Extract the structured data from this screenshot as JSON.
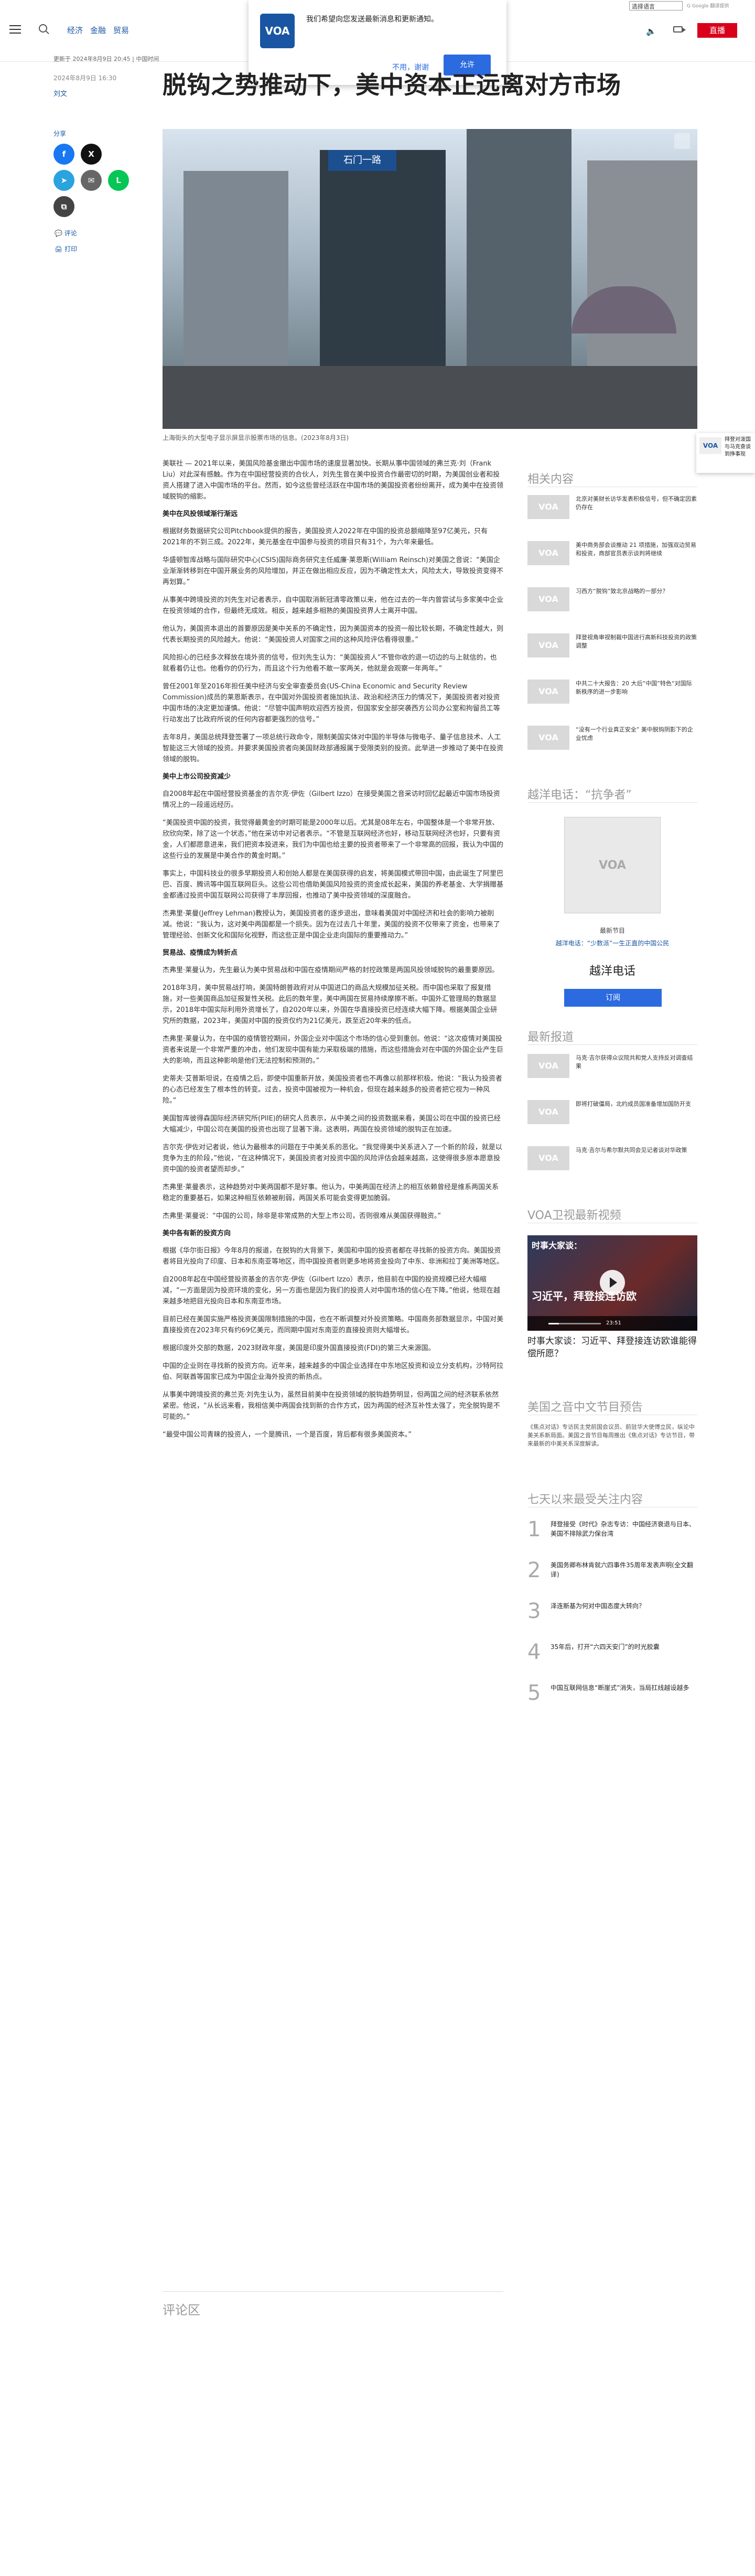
{
  "header": {
    "nav_links": [
      "经济",
      "金融",
      "贸易"
    ],
    "lang_select": "选择语言",
    "google_translate": "G Google 翻译提供",
    "live_label": "直播"
  },
  "notification": {
    "text": "我们希望向您发送最新消息和更新通知。",
    "decline": "不用，谢谢",
    "accept": "允许",
    "logo": "VOA"
  },
  "meta": {
    "updated": "更新于 2024年8月9日 20:45 | 中国时间",
    "date": "2024年8月9日 16:30",
    "author": "刘文"
  },
  "title": "脱钩之势推动下，美中资本正远离对方市场",
  "share": {
    "label": "分享",
    "buttons": [
      {
        "name": "facebook",
        "glyph": "f",
        "color": "#1877f2"
      },
      {
        "name": "x",
        "glyph": "X",
        "color": "#111111"
      },
      {
        "name": "telegram",
        "glyph": "➤",
        "color": "#2aa3df"
      },
      {
        "name": "email",
        "glyph": "✉",
        "color": "#666666"
      },
      {
        "name": "line",
        "glyph": "L",
        "color": "#06c755"
      },
      {
        "name": "copy-link",
        "glyph": "⧉",
        "color": "#444444"
      }
    ],
    "comment": "评论",
    "print": "打印"
  },
  "hero": {
    "sign": "石门一路",
    "caption": "上海街头的大型电子显示屏显示股票市场的信息。(2023年8月3日)"
  },
  "toast": {
    "logo": "VOA",
    "text": "拜登对泼国与马克查谈到挣事现"
  },
  "article": {
    "blocks": [
      {
        "type": "p",
        "text": "美联社 — 2021年以来，美国风险基金撤出中国市场的速度显著加快。长期从事中国领域的弗兰克·刘（Frank Liu）对此深有感触。作为在中国经营投资的合伙人，刘先生曾在美中投资合作最密切的时期，为美国创业者和投资人搭建了进入中国市场的平台。然而，如今这些曾经活跃在中国市场的美国投资者纷纷离开，成为美中在投资领域脱钩的缩影。"
      },
      {
        "type": "h",
        "text": "美中在风投领域渐行渐远"
      },
      {
        "type": "p",
        "text": "根据财务数据研究公司Pitchbook提供的报告，美国投资人2022年在中国的投资总额缩降至97亿美元，只有2021年的不到三成。2022年，美元基金在中国参与投资的项目只有31个，为六年来最低。"
      },
      {
        "type": "p",
        "text": "华盛顿智库战略与国际研究中心(CSIS)国际商务研究主任威廉·莱恩斯(William Reinsch)对美国之音说：“美国企业渐渐转移到在中国开展业务的风险增加，并正在做出相应反应，因为不确定性太大，风险太大，导致投资变得不再划算。”"
      },
      {
        "type": "p",
        "text": "从事美中跨境投资的刘先生对记者表示，自中国取消新冠清零政策以来，他在过去的一年内曾尝试与多家美中企业在投资领域的合作，但最终无成效。相反，越来越多相熟的美国投资界人士离开中国。"
      },
      {
        "type": "p",
        "text": "他认为，美国资本退出的首要原因是美中关系的不确定性，因为美国资本的投资一般比较长期，不确定性越大，则代表长期投资的风险越大。他说：“美国投资人对国家之间的这种风险评估看得很重。”"
      },
      {
        "type": "p",
        "text": "风险担心的已经多次释放在境外资的信号，但刘先生认为：“美国投资人”不管你收的退一切边的与上就信的，也就看着仍让也。他看你的仍行为，而且这个行为他看不敢一家两关，他就是会观察一年两年。”"
      },
      {
        "type": "p",
        "text": "曾任2001年至2016年担任美中经济与安全审查委员会(US-China Economic and Security Review Commission)成员的莱恩斯表示，在中国对外国投资者施加执法、政治和经济压力的情况下，美国投资者对投资中国市场的决定更加谨慎。他说：“尽管中国声明欢迎西方投资，但国家安全部突袭西方公司办公室和拘留员工等行动发出了比政府所说的任何内容都更强烈的信号。”"
      },
      {
        "type": "p",
        "text": "去年8月，美国总统拜登签署了一项总统行政命令，限制美国实体对中国的半导体与微电子、量子信息技术、人工智能这三大领域的投资。并要求美国投资者向美国财政部通报属于受限类别的投资。此举进一步推动了美中在投资领域的脱钩。"
      },
      {
        "type": "h",
        "text": "美中上市公司投资减少"
      },
      {
        "type": "p",
        "text": "自2008年起在中国经营投资基金的吉尔克·伊佐（Gilbert Izzo）在接受美国之音采访时回忆起最近中国市场投资情况上的一段遥远经历。"
      },
      {
        "type": "p",
        "text": "“美国投资中国的投资，我觉得最黄金的时期可能是2000年以后。尤其是08年左右，中国整体是一个非常开放、欣欣向荣，除了这一个状态，”他在采访中对记者表示。“不管是互联网经济也好，移动互联网经济也好，只要有资金，人们都愿意进来，我们把资本投进来，我们为中国也给主要的投资者带来了一个非常高的回报，我认为中国的这些行业的发展是中美合作的黄金时期。”"
      },
      {
        "type": "p",
        "text": "事实上，中国科技业的很多早期投资人和创始人都是在美国获得的启发，将美国模式带回中国，由此诞生了阿里巴巴、百度、腾讯等中国互联网巨头。这些公司也借助美国风险投资的资金成长起来，美国的养老基金、大学捐赠基金都通过投资中国互联网公司获得了丰厚回报，也推动了美中投资领域的深度融合。"
      },
      {
        "type": "p",
        "text": "杰弗里·莱曼(Jeffrey Lehman)教授认为，美国投资者的逐步退出，意味着美国对中国经济和社会的影响力被削减。他说：“我认为，这对美中两国都是一个损失。因为在过去几十年里，美国的投资不仅带来了资金，也带来了管理经验、创新文化和国际化视野，而这些正是中国企业走向国际的重要推动力。”"
      },
      {
        "type": "h",
        "text": "贸易战、疫情成为转折点"
      },
      {
        "type": "p",
        "text": "杰弗里·莱曼认为，先生最认为美中贸易战和中国在疫情期间严格的封控政策是两国风投领域脱钩的最重要原因。"
      },
      {
        "type": "p",
        "text": "2018年3月，美中贸易战打响，美国特朗普政府对从中国进口的商品大规模加征关税。而中国也采取了报复措施，对一些美国商品加征报复性关税。此后的数年里，美中两国在贸易持续摩擦不断。中国外汇管理局的数据显示，2018年中国实际利用外资增长了，自2020年以来，外国在华直接投资已经连续大幅下降。根据美国企业研究所的数据，2023年，美国对中国的投资仅约为21亿美元，跌至近20年来的低点。"
      },
      {
        "type": "p",
        "text": "杰弗里·莱曼认为，在中国的疫情管控期间，外国企业对中国这个市场的信心受到重创。他说：“这次疫情对美国投资者来说是一个非常严重的冲击，他们发现中国有能力采取极端的措施，而这些措施会对在中国的外国企业产生巨大的影响，而且这种影响是他们无法控制和预测的。”"
      },
      {
        "type": "p",
        "text": "史蒂夫·艾普斯坦说，在疫情之后，即使中国重新开放，美国投资者也不再像以前那样积极。他说：“我认为投资者的心态已经发生了根本性的转变。过去，投资中国被视为一种机会，但现在越来越多的投资者把它视为一种风险。”"
      },
      {
        "type": "p",
        "text": "美国智库彼得森国际经济研究所(PIIE)的研究人员表示，从中美之间的投资数据来看，美国公司在中国的投资已经大幅减少，中国公司在美国的投资也出现了显著下滑。这表明，两国在投资领域的脱钩正在加速。"
      },
      {
        "type": "p",
        "text": "吉尔克·伊佐对记者说，他认为最根本的问题在于中美关系的恶化。“我觉得美中关系进入了一个新的阶段，就是以竞争为主的阶段，”他说，“在这种情况下，美国投资者对投资中国的风险评估会越来越高，这使得很多原本愿意投资中国的投资者望而却步。”"
      },
      {
        "type": "p",
        "text": "杰弗里·莱曼表示，这种趋势对中美两国都不是好事。他认为，中美两国在经济上的相互依赖曾经是维系两国关系稳定的重要基石，如果这种相互依赖被削弱，两国关系可能会变得更加脆弱。"
      },
      {
        "type": "p",
        "text": "杰弗里·莱曼说：“中国的公司，除非是非常成熟的大型上市公司，否则很难从美国获得融资。”"
      },
      {
        "type": "h",
        "text": "美中各有新的投资方向"
      },
      {
        "type": "p",
        "text": "根据《华尔街日报》今年8月的报道，在脱钩的大背景下，美国和中国的投资者都在寻找新的投资方向。美国投资者将目光投向了印度、日本和东南亚等地区，而中国投资者则更多地将资金投向了中东、非洲和拉丁美洲等地区。"
      },
      {
        "type": "p",
        "text": "自2008年起在中国经营投资基金的吉尔克·伊佐（Gilbert Izzo）表示，他目前在中国的投资规模已经大幅缩减，“一方面是因为投资环境的变化，另一方面也是因为我们的投资人对中国市场的信心在下降。”他说，他现在越来越多地把目光投向日本和东南亚市场。"
      },
      {
        "type": "p",
        "text": "目前已经在美国实施严格投资美国限制措施的中国，也在不断调整对外投资策略。中国商务部数据显示，中国对美直接投资在2023年只有约69亿美元，而同期中国对东南亚的直接投资则大幅增长。"
      },
      {
        "type": "p",
        "text": "根据印度外交部的数据，2023财政年度，美国是印度外国直接投资(FDI)的第三大来源国。"
      },
      {
        "type": "p",
        "text": "中国的企业则在寻找新的投资方向。近年来，越来越多的中国企业选择在中东地区投资和设立分支机构，沙特阿拉伯、阿联酋等国家已成为中国企业海外投资的新热点。"
      },
      {
        "type": "p",
        "text": "从事美中跨境投资的弗兰克·刘先生认为，虽然目前美中在投资领域的脱钩趋势明显，但两国之间的经济联系依然紧密。他说，“从长远来看，我相信美中两国会找到新的合作方式，因为两国的经济互补性太强了，完全脱钩是不可能的。”"
      },
      {
        "type": "p",
        "text": "“最受中国公司青睐的投资人，一个是腾讯，一个是百度，背后都有很多美国资本。”"
      }
    ]
  },
  "comments_heading": "评论区",
  "sidebar": {
    "related_heading": "相关内容",
    "related": [
      "北京对美财长访华发表积极信号，但不确定因素仍存在",
      "美中商务部会谈推动 21 项措施，加强双边贸易和投资，商部官员表示谈判将继续",
      "习西方“脱钩”致北京战略的一部分？",
      "拜登视角审视制裁中国进行高新科技投资的政策调整",
      "中共二十大报告：20 大后“中国”特色“对国际新秩序的进一步影响",
      "“没有一个行业真正安全” 美中脱钩阴影下的企业忧虑"
    ],
    "podcast_heading": "越洋电话：“抗争者”",
    "podcast_logo": "VOA",
    "podcast_sub1": "最新节目",
    "podcast_sub2": "越洋电话：“少数派”一生正直的中国公民",
    "podcast_title": "越洋电话",
    "subscribe": "订阅",
    "latest_heading": "最新报道",
    "latest": [
      "马克·吉尔获得众议院共和党人支持反对调查结果",
      "即将打破僵局，北约成员国准备增加国防开支",
      "马克·吉尔与希尔默共同会见记者谈对华政策"
    ],
    "video_heading": "VOA卫视最新视频",
    "video": {
      "top_caption": "时事大家谈：",
      "main_caption": "习近平，拜登接连访欧",
      "time": "23:51",
      "title": "时事大家谈：习近平、拜登接连访欧谁能得偿所愿？"
    },
    "program_heading": "美国之音中文节目预告",
    "program_desc": "《焦点对话》专访民主党前国会议员、前驻华大使傅立民，纵论中美关系新局面。美国之音节目每周推出《焦点对话》专访节目，带来最新的中美关系深度解读。",
    "top_heading": "七天以来最受关注内容",
    "top": [
      {
        "num": "1",
        "text": "拜登接受《时代》杂志专访：中国经济衰退与日本、美国不排除武力保台湾"
      },
      {
        "num": "2",
        "text": "美国务卿布林肯就六四事件35周年发表声明(全文翻译)"
      },
      {
        "num": "3",
        "text": "泽连斯基为何对中国态度大转向？"
      },
      {
        "num": "4",
        "text": "35年后，打开“六四天安门”的时光胶囊"
      },
      {
        "num": "5",
        "text": "中国互联网信息“断崖式”消失，当局扛线越设越多"
      }
    ]
  }
}
